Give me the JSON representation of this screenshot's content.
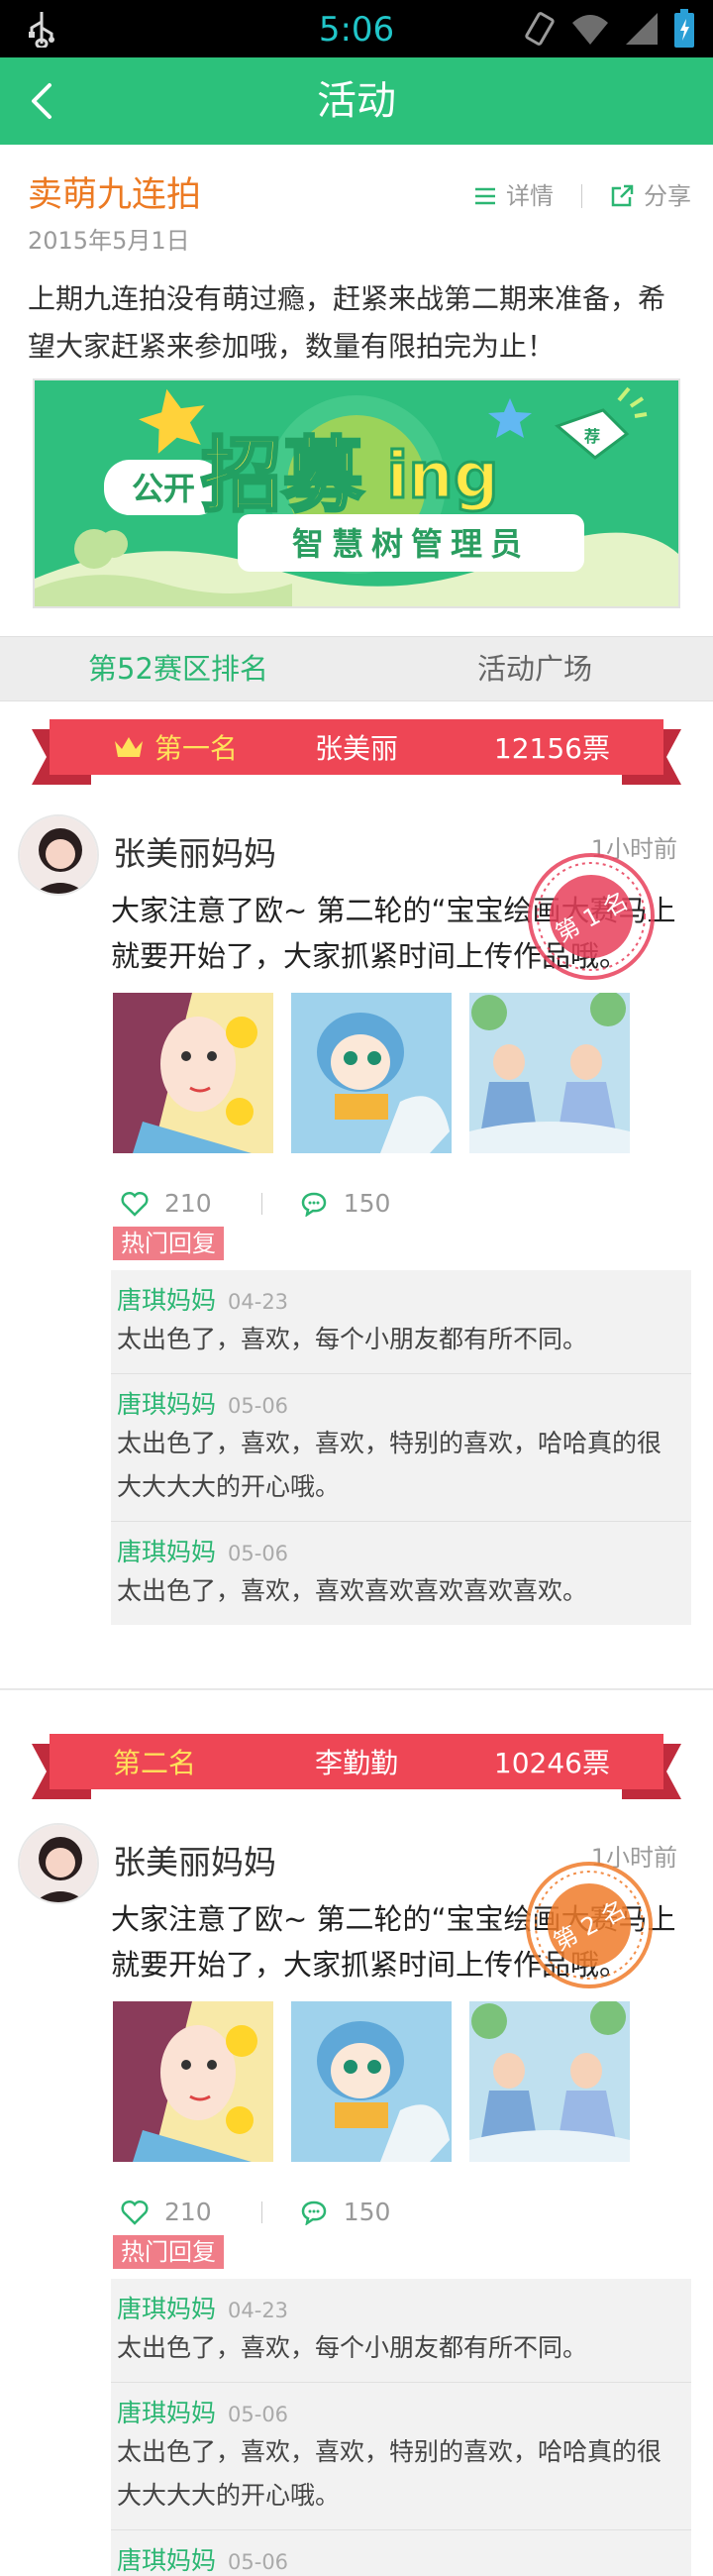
{
  "status_bar": {
    "time": "5:06"
  },
  "header": {
    "title": "活动"
  },
  "intro": {
    "title": "卖萌九连拍",
    "date": "2015年5月1日",
    "details_label": "详情",
    "share_label": "分享",
    "description": "上期九连拍没有萌过瘾，赶紧来战第二期来准备，希望大家赶紧来参加哦，数量有限拍完为止！"
  },
  "banner": {
    "line1_a": "公开",
    "line1_b": "招募",
    "line1_c": "ing",
    "line2": "智慧树管理员"
  },
  "tabs": [
    {
      "label": "第52赛区排名"
    },
    {
      "label": "活动广场"
    }
  ],
  "rankings": [
    {
      "rank_label": "第一名",
      "name": "张美丽",
      "votes": "12156票",
      "author": "张美丽妈妈",
      "time": "1小时前",
      "text": "大家注意了欧~ 第二轮的“宝宝绘画大赛马上就要开始了，大家抓紧时间上传作品哦。",
      "stamp": "第 1 名",
      "likes": "210",
      "comments": "150",
      "hot_label": "热门回复",
      "replies": [
        {
          "name": "唐琪妈妈",
          "date": "04-23",
          "text": "太出色了，喜欢，每个小朋友都有所不同。"
        },
        {
          "name": "唐琪妈妈",
          "date": "05-06",
          "text": "太出色了，喜欢，喜欢，特别的喜欢，哈哈真的很大大大大的开心哦。"
        },
        {
          "name": "唐琪妈妈",
          "date": "05-06",
          "text": "太出色了，喜欢，喜欢喜欢喜欢喜欢喜欢。"
        }
      ]
    },
    {
      "rank_label": "第二名",
      "name": "李勤勤",
      "votes": "10246票",
      "author": "张美丽妈妈",
      "time": "1小时前",
      "text": "大家注意了欧~ 第二轮的“宝宝绘画大赛马上就要开始了，大家抓紧时间上传作品哦。",
      "stamp": "第 2 名",
      "likes": "210",
      "comments": "150",
      "hot_label": "热门回复",
      "replies": [
        {
          "name": "唐琪妈妈",
          "date": "04-23",
          "text": "太出色了，喜欢，每个小朋友都有所不同。"
        },
        {
          "name": "唐琪妈妈",
          "date": "05-06",
          "text": "太出色了，喜欢，喜欢，特别的喜欢，哈哈真的很大大大大的开心哦。"
        },
        {
          "name": "唐琪妈妈",
          "date": "05-06",
          "text": ""
        }
      ]
    }
  ],
  "colors": {
    "brand_green": "#2cc17b",
    "orange": "#ec7a23",
    "ribbon_red": "#ee4655",
    "stamp_red": "#e8405a",
    "stamp_orange": "#f07b2a"
  },
  "icons": [
    "usb-icon",
    "vibrate-icon",
    "wifi-icon",
    "signal-icon",
    "battery-icon",
    "back-icon",
    "list-icon",
    "share-icon",
    "crown-icon",
    "heart-icon",
    "comment-icon"
  ]
}
